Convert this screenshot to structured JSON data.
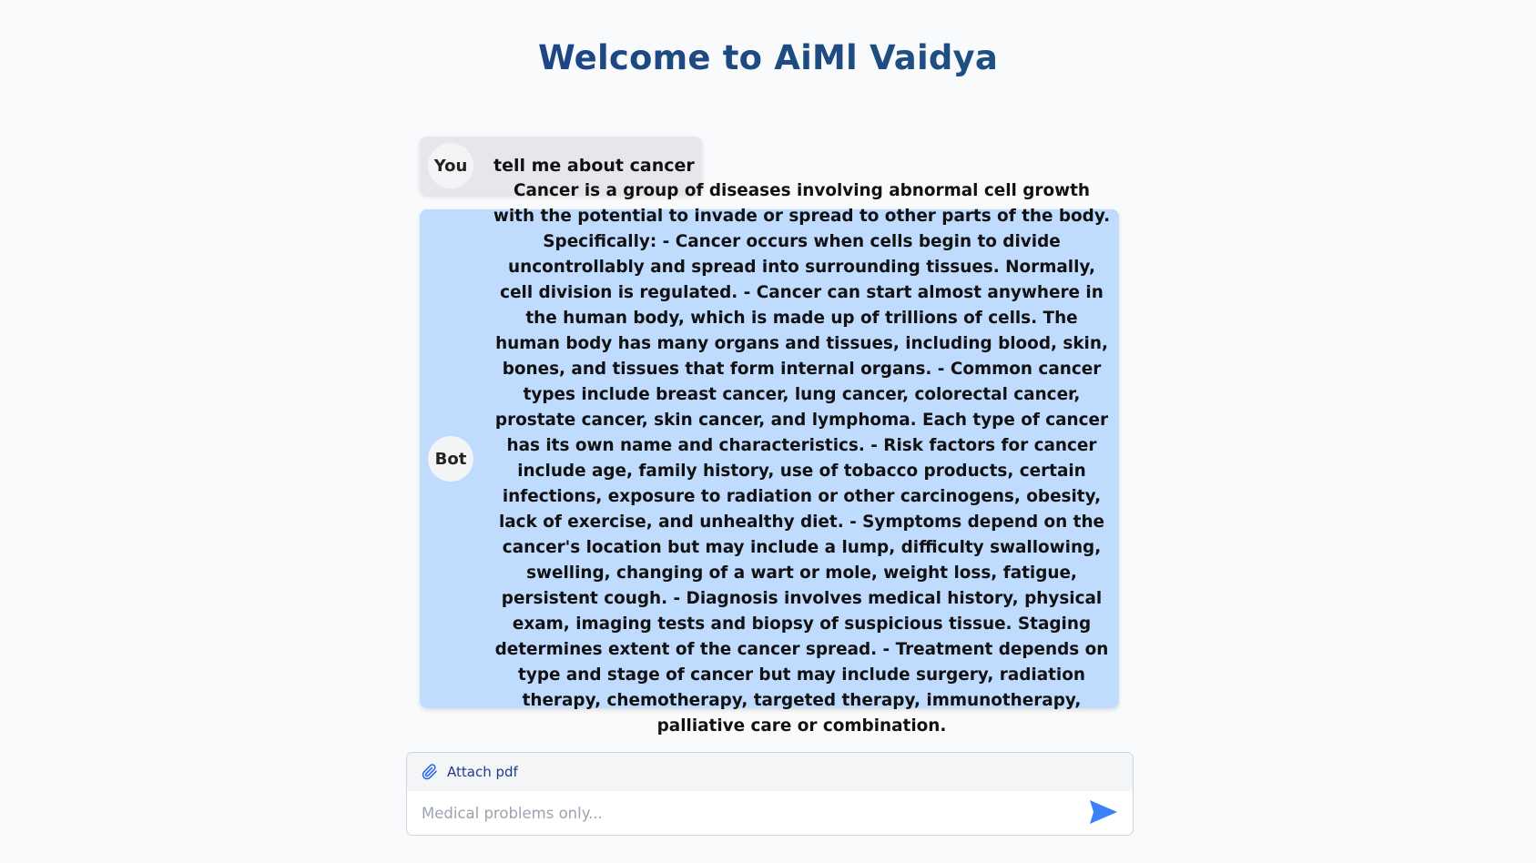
{
  "header": {
    "title": "Welcome to AiMl Vaidya"
  },
  "colors": {
    "title": "#1e3a8a",
    "user_bubble": "#e5e7eb",
    "bot_bubble": "#bfdbfe",
    "send_icon": "#3b82f6",
    "attach_icon": "#2563eb"
  },
  "messages": [
    {
      "role": "user",
      "avatar_label": "You",
      "text": "tell me about cancer"
    },
    {
      "role": "bot",
      "avatar_label": "Bot",
      "text": "Cancer is a group of diseases involving abnormal cell growth with the potential to invade or spread to other parts of the body. Specifically: - Cancer occurs when cells begin to divide uncontrollably and spread into surrounding tissues. Normally, cell division is regulated. - Cancer can start almost anywhere in the human body, which is made up of trillions of cells. The human body has many organs and tissues, including blood, skin, bones, and tissues that form internal organs. - Common cancer types include breast cancer, lung cancer, colorectal cancer, prostate cancer, skin cancer, and lymphoma. Each type of cancer has its own name and characteristics. - Risk factors for cancer include age, family history, use of tobacco products, certain infections, exposure to radiation or other carcinogens, obesity, lack of exercise, and unhealthy diet. - Symptoms depend on the cancer's location but may include a lump, difficulty swallowing, swelling, changing of a wart or mole, weight loss, fatigue, persistent cough. - Diagnosis involves medical history, physical exam, imaging tests and biopsy of suspicious tissue. Staging determines extent of the cancer spread. - Treatment depends on type and stage of cancer but may include surgery, radiation therapy, chemotherapy, targeted therapy, immunotherapy, palliative care or combination."
    }
  ],
  "composer": {
    "attach_label": "Attach pdf",
    "attach_icon": "paperclip-icon",
    "input_value": "",
    "input_placeholder": "Medical problems only...",
    "send_icon": "send-arrow-icon"
  }
}
